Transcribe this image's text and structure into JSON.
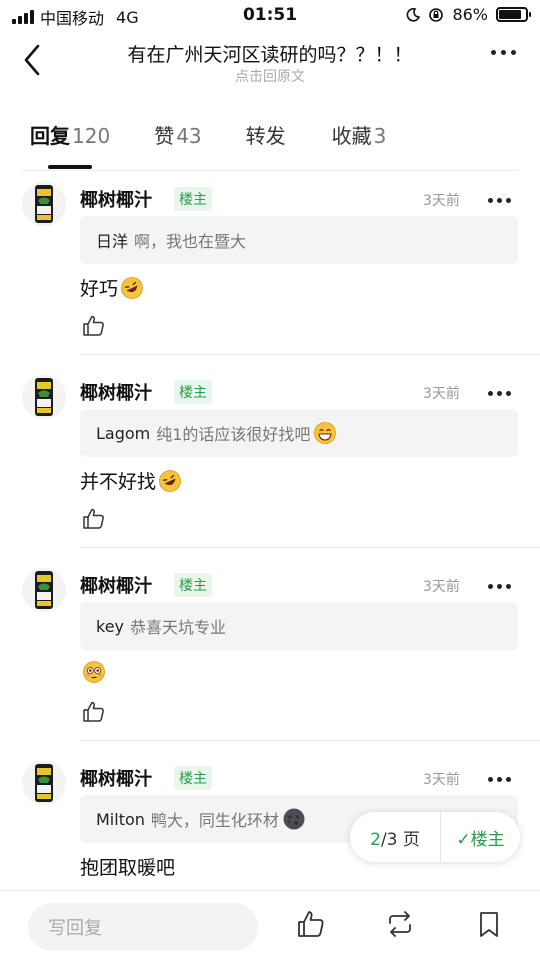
{
  "status_bar": {
    "carrier": "中国移动",
    "network": "4G",
    "time": "01:51",
    "battery": "86%",
    "battery_level": 0.86
  },
  "header": {
    "title": "有在广州天河区读研的吗？？！！",
    "subtitle": "点击回原文"
  },
  "tabs": [
    {
      "label": "回复",
      "count": "120"
    },
    {
      "label": "赞",
      "count": "43"
    },
    {
      "label": "转发",
      "count": ""
    },
    {
      "label": "收藏",
      "count": "3"
    }
  ],
  "posts": [
    {
      "author": "椰树椰汁",
      "badge": "楼主",
      "time": "3天前",
      "quote_name": "日洋",
      "quote_text": "啊，我也在暨大",
      "quote_emoji": "",
      "content": "好巧",
      "content_emoji": "rofl-emoji"
    },
    {
      "author": "椰树椰汁",
      "badge": "楼主",
      "time": "3天前",
      "quote_name": "Lagom",
      "quote_text": "纯1的话应该很好找吧",
      "quote_emoji": "grin-emoji",
      "content": "并不好找",
      "content_emoji": "rofl-emoji"
    },
    {
      "author": "椰树椰汁",
      "badge": "楼主",
      "time": "3天前",
      "quote_name": "key",
      "quote_text": "恭喜天坑专业",
      "quote_emoji": "",
      "content": "",
      "content_emoji": "flushed-emoji"
    },
    {
      "author": "椰树椰汁",
      "badge": "楼主",
      "time": "3天前",
      "quote_name": "Milton",
      "quote_text": "鸭大，同生化环材",
      "quote_emoji": "new-moon-face-emoji",
      "content": "抱团取暖吧",
      "content_emoji": ""
    }
  ],
  "pager": {
    "current": "2",
    "total": "/3 页",
    "owner_label": "✓楼主"
  },
  "bottom": {
    "reply_placeholder": "写回复"
  },
  "colors": {
    "accent_green": "#2a9d4b",
    "quote_bg": "#f4f4f4"
  }
}
